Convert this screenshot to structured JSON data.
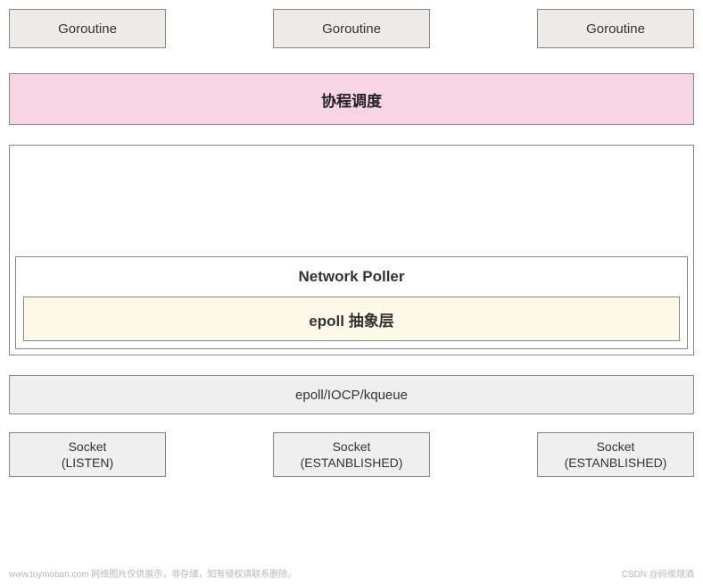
{
  "goroutines": {
    "item1": "Goroutine",
    "item2": "Goroutine",
    "item3": "Goroutine"
  },
  "scheduler": {
    "label": "协程调度"
  },
  "poller": {
    "title": "Network Poller",
    "abstract": "epoll 抽象层"
  },
  "os_layer": {
    "label": "epoll/IOCP/kqueue"
  },
  "sockets": {
    "s1": {
      "name": "Socket",
      "state": "(LISTEN)"
    },
    "s2": {
      "name": "Socket",
      "state": "(ESTANBLISHED)"
    },
    "s3": {
      "name": "Socket",
      "state": "(ESTANBLISHED)"
    }
  },
  "watermarks": {
    "left": "www.toymoban.com 网络图片仅供展示，非存储，如有侵权请联系删除。",
    "right": "CSDN @码侯烧酒"
  }
}
